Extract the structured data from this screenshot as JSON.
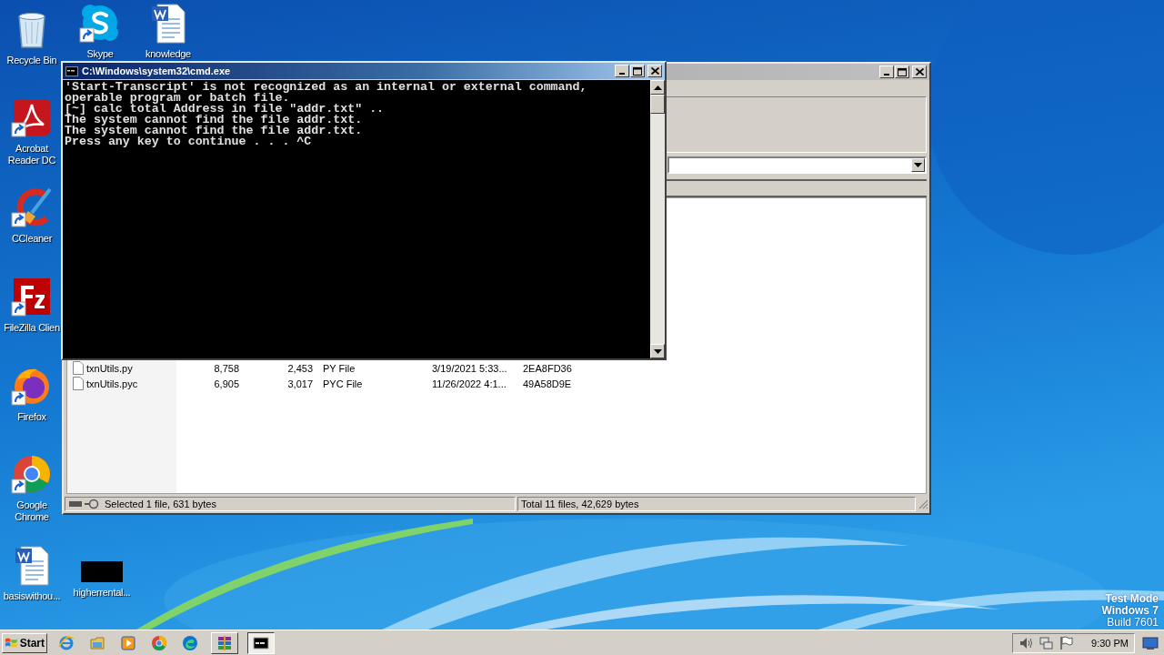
{
  "desktop_icons": [
    {
      "label": "Recycle Bin",
      "kind": "recycle",
      "shortcut": false
    },
    {
      "label": "Skype",
      "kind": "skype",
      "shortcut": true
    },
    {
      "label": "knowledge",
      "kind": "word",
      "shortcut": false
    },
    {
      "label": "Acrobat Reader DC",
      "kind": "acrobat",
      "shortcut": true
    },
    {
      "label": "CCleaner",
      "kind": "ccleaner",
      "shortcut": true
    },
    {
      "label": "FileZilla Clien",
      "kind": "filezilla",
      "shortcut": true
    },
    {
      "label": "Firefox",
      "kind": "firefox",
      "shortcut": true
    },
    {
      "label": "Google Chrome",
      "kind": "chrome",
      "shortcut": true
    },
    {
      "label": "basiswithou...",
      "kind": "word",
      "shortcut": false
    },
    {
      "label": "higherrental...",
      "kind": "thumbnail",
      "shortcut": false
    }
  ],
  "archive_window": {
    "files": [
      {
        "cells": [
          "txnUtils.py",
          "8,758",
          "2,453",
          "PY File",
          "3/19/2021 5:33...",
          "2EA8FD36"
        ]
      },
      {
        "cells": [
          "txnUtils.pyc",
          "6,905",
          "3,017",
          "PYC File",
          "11/26/2022 4:1...",
          "49A58D9E"
        ]
      }
    ],
    "status_left": "Selected 1 file, 631 bytes",
    "status_right": "Total 11 files, 42,629 bytes"
  },
  "console_window": {
    "title": "C:\\Windows\\system32\\cmd.exe",
    "lines": [
      "'Start-Transcript' is not recognized as an internal or external command,",
      "operable program or batch file.",
      "[~] calc total Address in file \"addr.txt\" ..",
      "The system cannot find the file addr.txt.",
      "The system cannot find the file addr.txt.",
      "Press any key to continue . . . ^C"
    ]
  },
  "taskbar": {
    "start": "Start",
    "apps": [
      {
        "kind": "ie",
        "running": false,
        "active": false
      },
      {
        "kind": "folder",
        "running": false,
        "active": false
      },
      {
        "kind": "media",
        "running": false,
        "active": false
      },
      {
        "kind": "chrome",
        "running": false,
        "active": false
      },
      {
        "kind": "edge",
        "running": false,
        "active": false
      },
      {
        "kind": "archiver",
        "running": true,
        "active": false
      },
      {
        "kind": "console",
        "running": true,
        "active": true
      }
    ],
    "clock": "9:30 PM"
  },
  "system_notice": [
    "Test Mode",
    "Windows 7",
    "Build 7601"
  ]
}
